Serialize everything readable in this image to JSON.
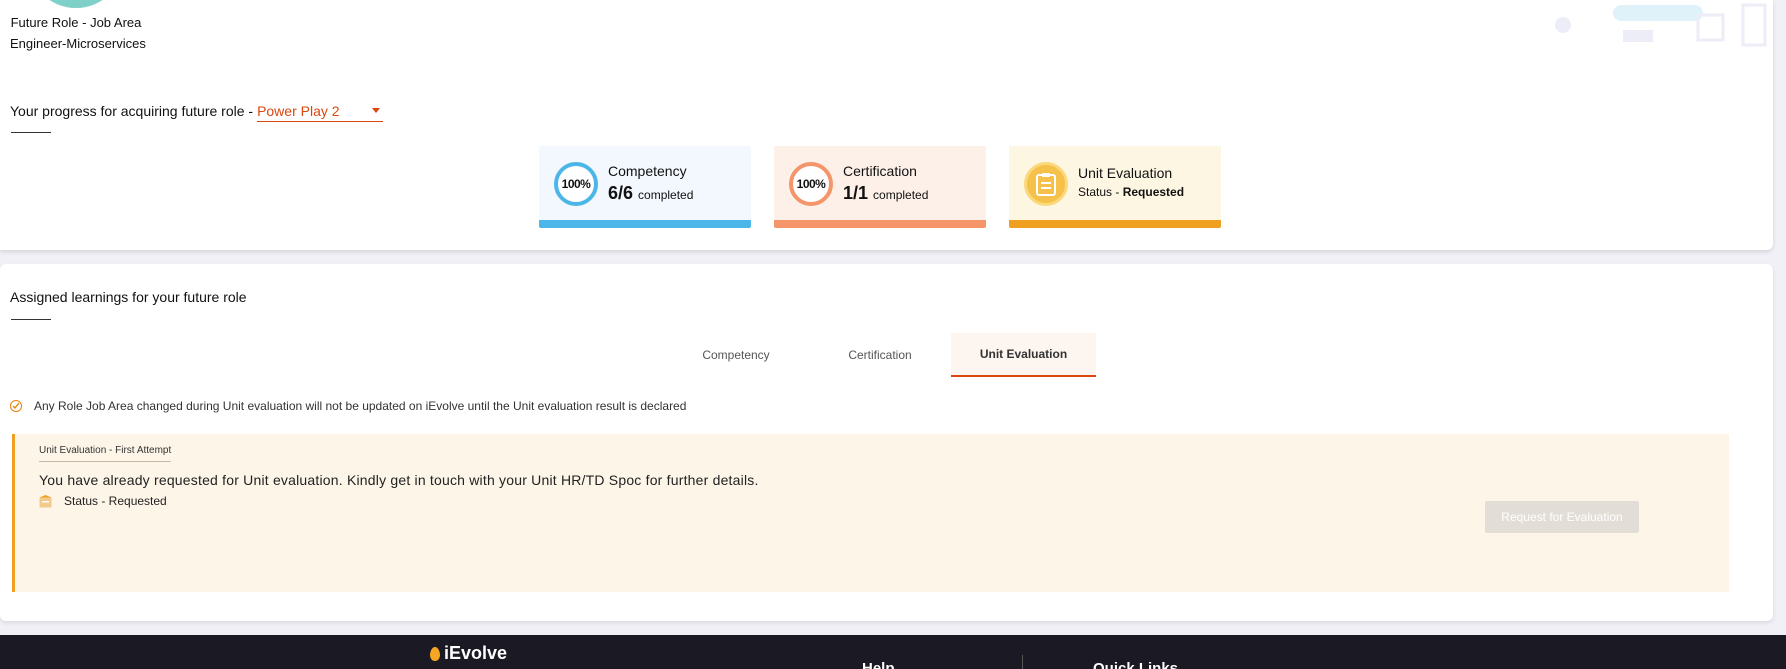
{
  "profile": {
    "role_label": "Future Role - Job Area",
    "role_value": "Engineer-Microservices"
  },
  "progress": {
    "prefix": "Your progress for acquiring future role -",
    "selected_role": "Power Play 2"
  },
  "stats": {
    "competency": {
      "percent_label": "100%",
      "title": "Competency",
      "value": "6/6",
      "suffix": "completed",
      "color": "#4db6e8",
      "bg": "#f2f8fd",
      "progress": 1.0
    },
    "certification": {
      "percent_label": "100%",
      "title": "Certification",
      "value": "1/1",
      "suffix": "completed",
      "color": "#f4956a",
      "bg": "#fdf0e9",
      "progress": 1.0
    },
    "unit_eval": {
      "title": "Unit Evaluation",
      "status_prefix": "Status -",
      "status": "Requested",
      "icon": "clipboard-checklist-icon",
      "color": "#f0a020",
      "bg": "#fdf6e3"
    }
  },
  "assigned": {
    "title": "Assigned learnings for your future role"
  },
  "tabs": [
    {
      "label": "Competency"
    },
    {
      "label": "Certification"
    },
    {
      "label": "Unit Evaluation",
      "active": true
    }
  ],
  "notice": "Any Role Job Area changed during Unit evaluation will not be updated on iEvolve until the Unit evaluation result is declared",
  "evaluation": {
    "attempt_label": "Unit Evaluation - First Attempt",
    "message": "You have already requested for Unit evaluation. Kindly get in touch with your Unit HR/TD Spoc for further details.",
    "status": "Status - Requested",
    "button_label": "Request for Evaluation"
  },
  "footer": {
    "logo": "iEvolve",
    "help": "Help",
    "quick_links": "Quick Links"
  },
  "colors": {
    "accent": "#d9480f",
    "footer_bg": "#1b1a24"
  }
}
